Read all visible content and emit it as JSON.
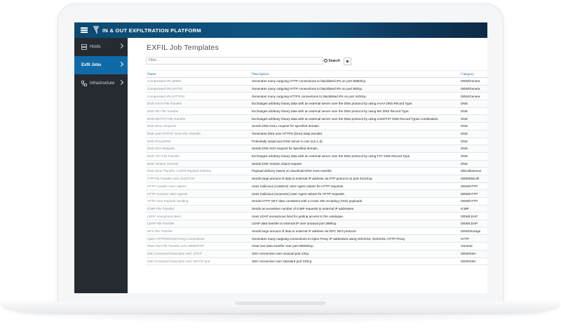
{
  "app": {
    "title": "IN & OUT EXFILTRATION PLATFORM"
  },
  "sidebar": {
    "items": [
      {
        "label": "Hosts",
        "icon": "server-icon"
      },
      {
        "label": "Exfil Jobs",
        "icon": ""
      },
      {
        "label": "Infrastructure",
        "icon": "network-icon"
      }
    ]
  },
  "main": {
    "title": "EXFIL Job Templates",
    "filter_placeholder": "Filter...",
    "search_label": "Search"
  },
  "table": {
    "headers": [
      "Name",
      "Description",
      "Category"
    ],
    "rows": [
      {
        "name": "Compressed IPs (8080)",
        "desc": "Generates many outgoing HTTP connections to blacklisted IPs on port 8080/tcp.",
        "cat": "DEW/Genera"
      },
      {
        "name": "Compressed IPs (HTTP)",
        "desc": "Generates many outgoing HTTP connections to blacklisted IPs on port 80/tcp.",
        "cat": "DEW/Genera"
      },
      {
        "name": "Compressed IPs (HTTPS)",
        "desc": "Generates many outgoing HTTPS connections to blacklisted IPs on port 443/tcp.",
        "cat": "DEW/Genera"
      },
      {
        "name": "DNS AAAA File Transfer",
        "desc": "Exchanges arbitrary binary data with an external server over the DNS protocol by using AAAA DNS Record Type.",
        "cat": "DNS"
      },
      {
        "name": "DNS MX File Transfer",
        "desc": "Exchanges arbitrary binary data with an external server over the DNS protocol by using MX DNS Record Type.",
        "cat": "DNS"
      },
      {
        "name": "DNS MX/TXT File Transfer",
        "desc": "Exchanges arbitrary binary data with an external server over the DNS protocol by using a MX/TXT DNS Record Types combination.",
        "cat": "DNS"
      },
      {
        "name": "DNS NULL Request",
        "desc": "Sends DNS NULL request for specified domain.",
        "cat": "DNS"
      },
      {
        "name": "DNS over HTTPS / DoH File Transfer",
        "desc": "Generates DNS over HTTPS (DoH) Data transfer.",
        "cat": "DNS"
      },
      {
        "name": "DNS Proxy/DNS",
        "desc": "Potentially suspicious DNS server in use (a.b.c.d).",
        "cat": "DNS"
      },
      {
        "name": "DNS SOA Request",
        "desc": "Sends DNS SOA request for specified domain.",
        "cat": "DNS"
      },
      {
        "name": "DNS TXT File Transfer",
        "desc": "Exchanges arbitrary binary data with an external server over the DNS protocol by using TXT DNS Record Type.",
        "cat": "DNS"
      },
      {
        "name": "DNS Version CHAOS",
        "desc": "Sends DNS Version chaos request.",
        "cat": "DNS"
      },
      {
        "name": "DNS Zone Transfer / AXFR Payload Delivery",
        "desc": "Payload delivery based on download DNS zone transfer.",
        "cat": "Miscellaneous"
      },
      {
        "name": "FTP File Transfer over 2121/TCP",
        "desc": "Sends large amount of data to external IP address via FTP protocol on port 2121/tcp.",
        "cat": "DEW/Miscell"
      },
      {
        "name": "HTTP Crawler User-Agents",
        "desc": "Uses malicious (crawlers) User-Agent values for HTTP requests.",
        "cat": "DEW/HTTP"
      },
      {
        "name": "HTTP Scanner User-Agents",
        "desc": "Uses malicious (scanners) User-Agent values for HTTP requests.",
        "cat": "DEW/HTTP"
      },
      {
        "name": "HTTP XSS Payload Sending",
        "desc": "Sends HTTP GET data consistent with a Cross Site Scripting (XSS) payloads.",
        "cat": "DEW/HTTP"
      },
      {
        "name": "ICMP File Transfer",
        "desc": "Sends an excessive number of ICMP requests to external IP addresses.",
        "cat": "ICMP"
      },
      {
        "name": "LDAP Anonymous Bind",
        "desc": "Uses LDAP anonymous bind for getting access to the catalogue.",
        "cat": "DEW/LDAP"
      },
      {
        "name": "LDAP File Transfer",
        "desc": "LDAP data transfer to external IP over unusual port 389/tcp.",
        "cat": "DEW/LDAP"
      },
      {
        "name": "NFS File Transfer",
        "desc": "Sends large amount of data to external IP address via RPC NFS protocol.",
        "cat": "DEW/Storage"
      },
      {
        "name": "Open HTTP/SOCKS Proxy Connections",
        "desc": "Generates many outgoing connections to Open Proxy IP addresses using SOCKS4, SOCKS5, HTTP Proxy.",
        "cat": "HTTP"
      },
      {
        "name": "Plain Text File Transfer over 65000/TCP",
        "desc": "Clear text data transfer over port 65000/tcp.",
        "cat": "General"
      },
      {
        "name": "SSH Command Execution over 1/TCP",
        "desc": "SSH connection over unusual port 1/tcp.",
        "cat": "DEW/SSH"
      },
      {
        "name": "SSH Command Execution over 22/TCP port",
        "desc": "SSH connection over standard port 22/tcp.",
        "cat": "DEW/SSH"
      }
    ]
  },
  "colors": {
    "topbar": "#0f5582",
    "sidebar": "#262b31",
    "active": "#0f6aa8",
    "header_text": "#2d6aa6"
  }
}
